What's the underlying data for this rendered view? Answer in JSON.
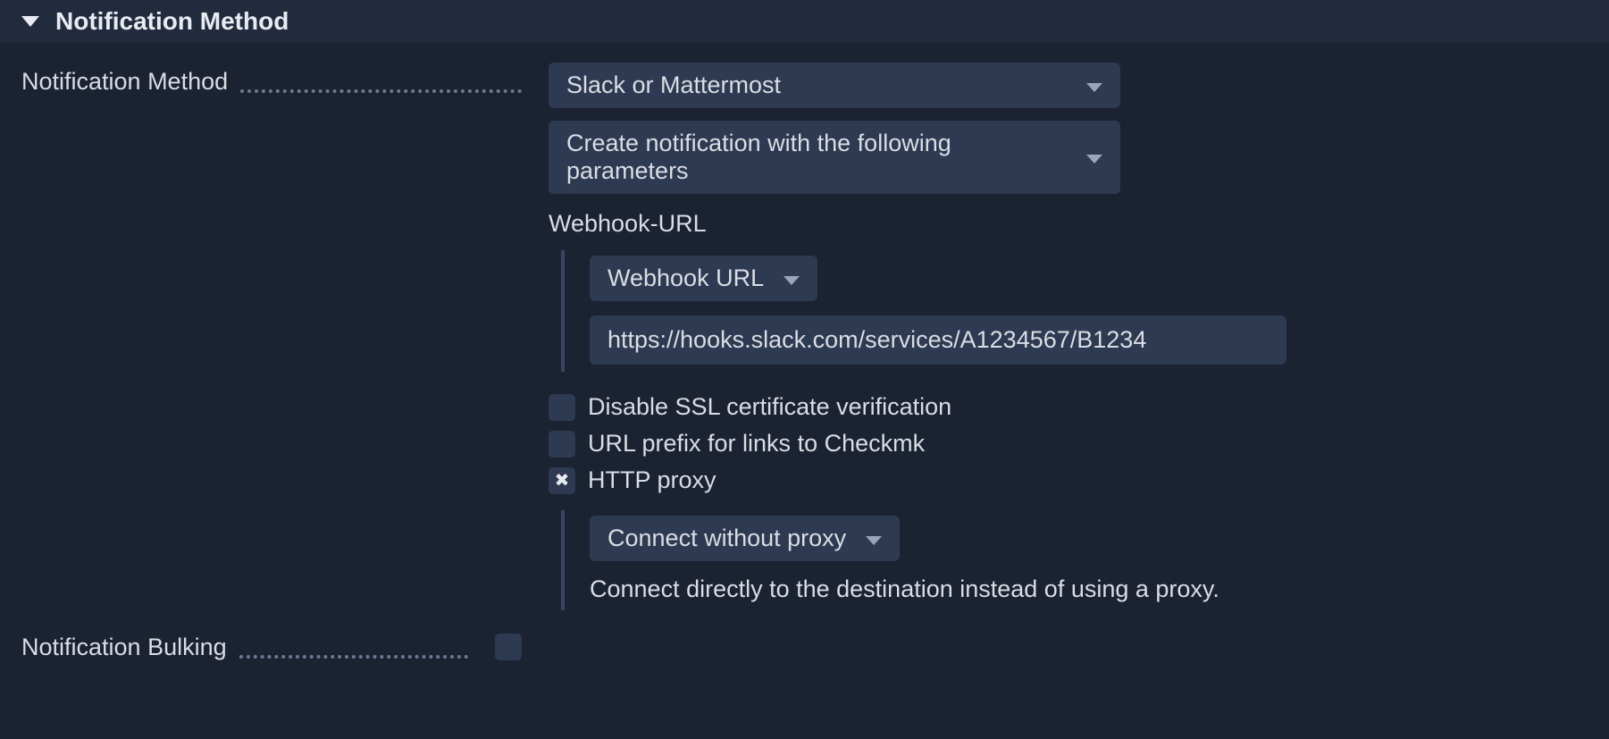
{
  "section": {
    "title": "Notification Method"
  },
  "method": {
    "label": "Notification Method",
    "selected": "Slack or Mattermost",
    "mode": "Create notification with the following parameters",
    "webhook_section_label": "Webhook-URL",
    "webhook_type": "Webhook URL",
    "webhook_url": "https://hooks.slack.com/services/A1234567/B1234",
    "opt_disable_ssl": "Disable SSL certificate verification",
    "opt_url_prefix": "URL prefix for links to Checkmk",
    "opt_http_proxy": "HTTP proxy",
    "proxy_selected": "Connect without proxy",
    "proxy_help": "Connect directly to the destination instead of using a proxy."
  },
  "bulking": {
    "label": "Notification Bulking"
  }
}
